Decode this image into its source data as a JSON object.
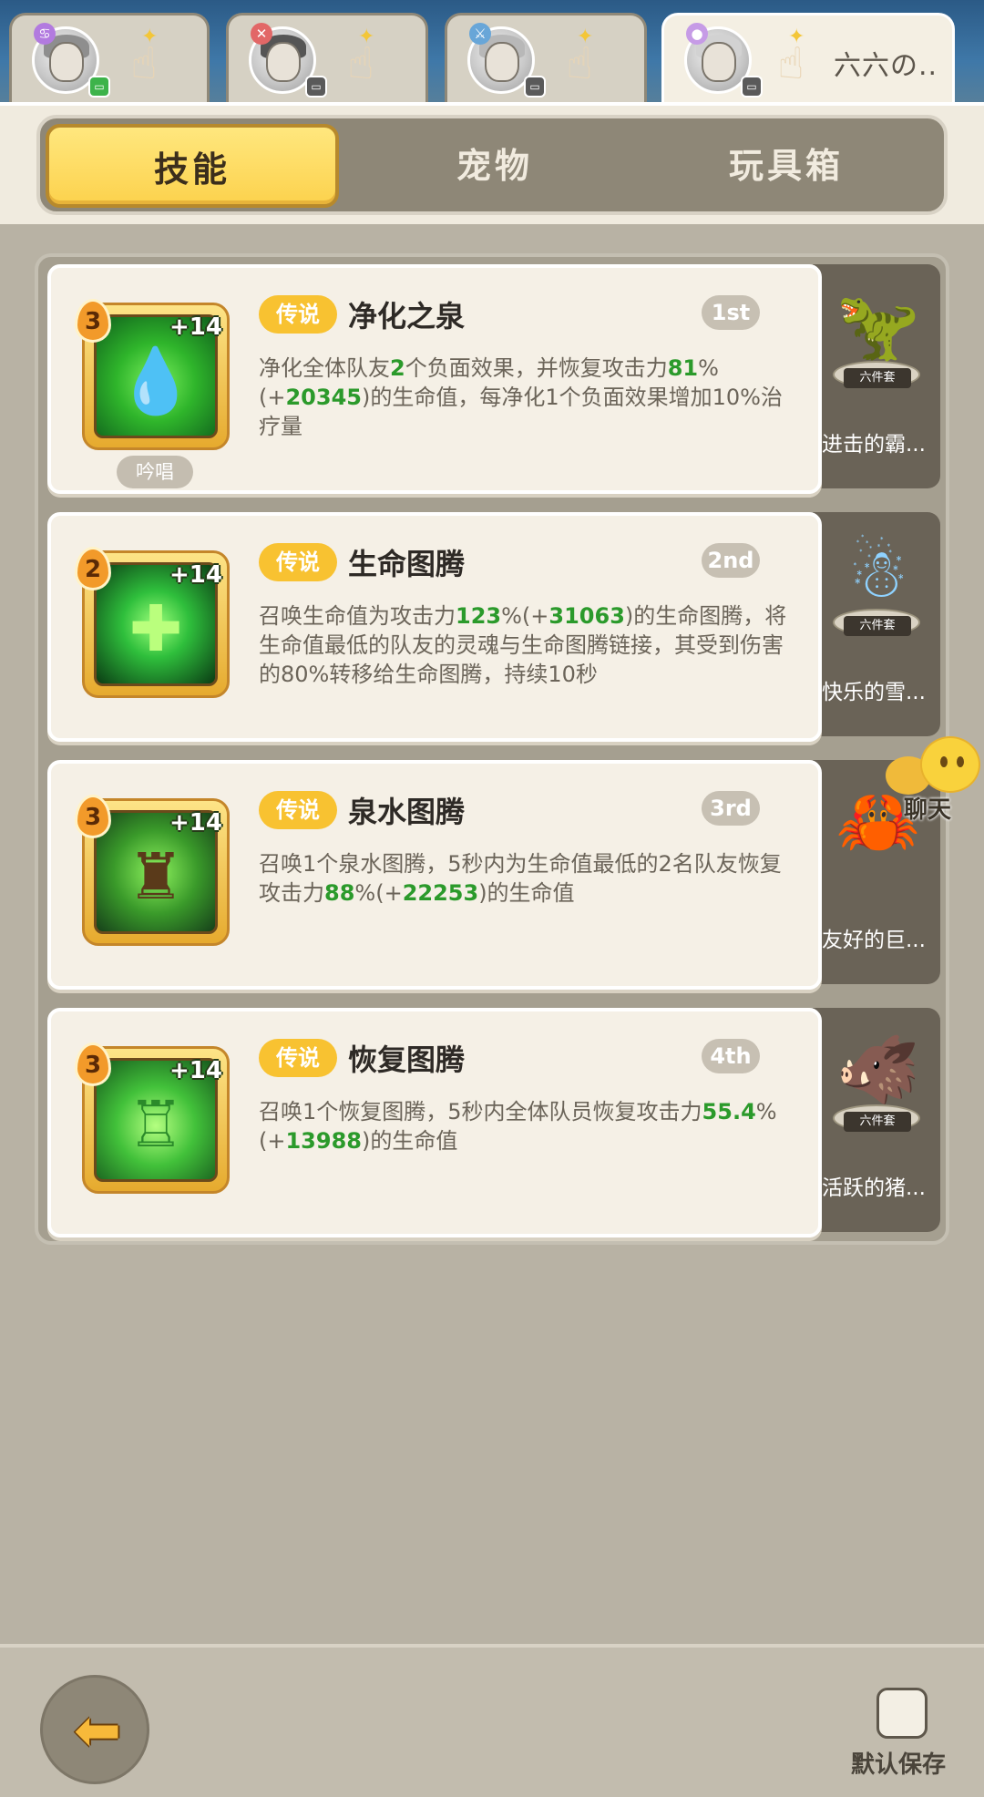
{
  "characters": [
    {
      "elem_icon": "♋",
      "elem_color": "#b27adf",
      "status_color": "#3db34a",
      "name": ""
    },
    {
      "elem_icon": "✕",
      "elem_color": "#e26767",
      "status_color": "#5a5a5a",
      "name": ""
    },
    {
      "elem_icon": "⚔",
      "elem_color": "#68a6d8",
      "status_color": "#5a5a5a",
      "name": ""
    },
    {
      "elem_icon": "●",
      "elem_color": "#c69be6",
      "status_color": "#5a5a5a",
      "name": "六六の.."
    }
  ],
  "tabs": [
    "技能",
    "宠物",
    "玩具箱"
  ],
  "skills": [
    {
      "level": "3",
      "plus": "+14",
      "cast": "吟唱",
      "rarity": "传说",
      "title": "净化之泉",
      "rank": "1st",
      "desc": [
        {
          "t": "净化全体队友",
          "h": false
        },
        {
          "t": "2",
          "h": true
        },
        {
          "t": "个负面效果，并恢复攻击力",
          "h": false
        },
        {
          "t": "81",
          "h": true
        },
        {
          "t": "%(+",
          "h": false
        },
        {
          "t": "20345",
          "h": true
        },
        {
          "t": ")的生命值，每净化1个负面效果增加10%治疗量",
          "h": false
        }
      ],
      "glyph": "💧",
      "pet_name": "进击的霸...",
      "pet_set": "六件套",
      "pet_emoji": "🦖"
    },
    {
      "level": "2",
      "plus": "+14",
      "cast": "",
      "rarity": "传说",
      "title": "生命图腾",
      "rank": "2nd",
      "desc": [
        {
          "t": "召唤生命值为攻击力",
          "h": false
        },
        {
          "t": "123",
          "h": true
        },
        {
          "t": "%(+",
          "h": false
        },
        {
          "t": "31063",
          "h": true
        },
        {
          "t": ")的生命图腾，将生命值最低的队友的灵魂与生命图腾链接，其受到伤害的80%转移给生命图腾，持续10秒",
          "h": false
        }
      ],
      "glyph": "✚",
      "pet_name": "快乐的雪...",
      "pet_set": "六件套",
      "pet_emoji": "☃"
    },
    {
      "level": "3",
      "plus": "+14",
      "cast": "",
      "rarity": "传说",
      "title": "泉水图腾",
      "rank": "3rd",
      "desc": [
        {
          "t": "召唤1个泉水图腾，5秒内为生命值最低的2名队友恢复攻击力",
          "h": false
        },
        {
          "t": "88",
          "h": true
        },
        {
          "t": "%(+",
          "h": false
        },
        {
          "t": "22253",
          "h": true
        },
        {
          "t": ")的生命值",
          "h": false
        }
      ],
      "glyph": "♜",
      "pet_name": "友好的巨...",
      "pet_set": "",
      "pet_emoji": "🦀"
    },
    {
      "level": "3",
      "plus": "+14",
      "cast": "",
      "rarity": "传说",
      "title": "恢复图腾",
      "rank": "4th",
      "desc": [
        {
          "t": "召唤1个恢复图腾，5秒内全体队员恢复攻击力",
          "h": false
        },
        {
          "t": "55.4",
          "h": true
        },
        {
          "t": "%(+",
          "h": false
        },
        {
          "t": "13988",
          "h": true
        },
        {
          "t": ")的生命值",
          "h": false
        }
      ],
      "glyph": "♖",
      "pet_name": "活跃的猪...",
      "pet_set": "六件套",
      "pet_emoji": "🐗"
    }
  ],
  "chat_label": "聊天",
  "bottom": {
    "save_label": "默认保存",
    "back_arrow": "⬅"
  },
  "colors": {
    "highlight": "#2b9a2b",
    "rarity": "#f8c231",
    "active_tab": "#fcd24d"
  }
}
